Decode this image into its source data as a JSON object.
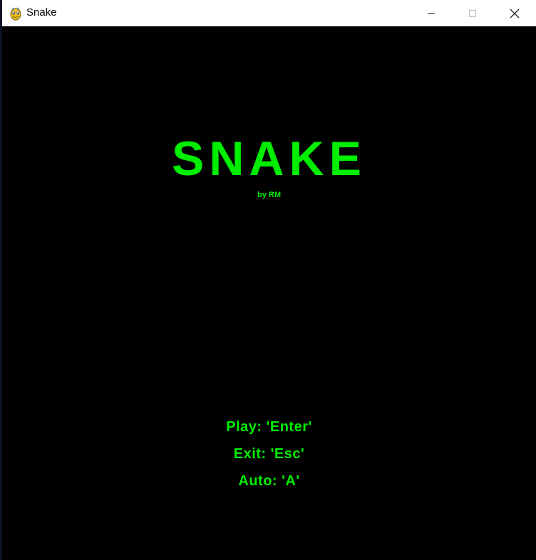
{
  "window": {
    "title": "Snake",
    "icon": "pygame-snake-icon",
    "controls": [
      "minimize-icon",
      "maximize-icon",
      "close-icon"
    ]
  },
  "game": {
    "title": "SNAKE",
    "subtitle": "by RM",
    "menu": {
      "play": "Play: 'Enter'",
      "exit": "Exit: 'Esc'",
      "auto": "Auto: 'A'"
    }
  },
  "colors": {
    "background": "#000000",
    "text": "#00ee00",
    "titlebar": "#ffffff"
  }
}
